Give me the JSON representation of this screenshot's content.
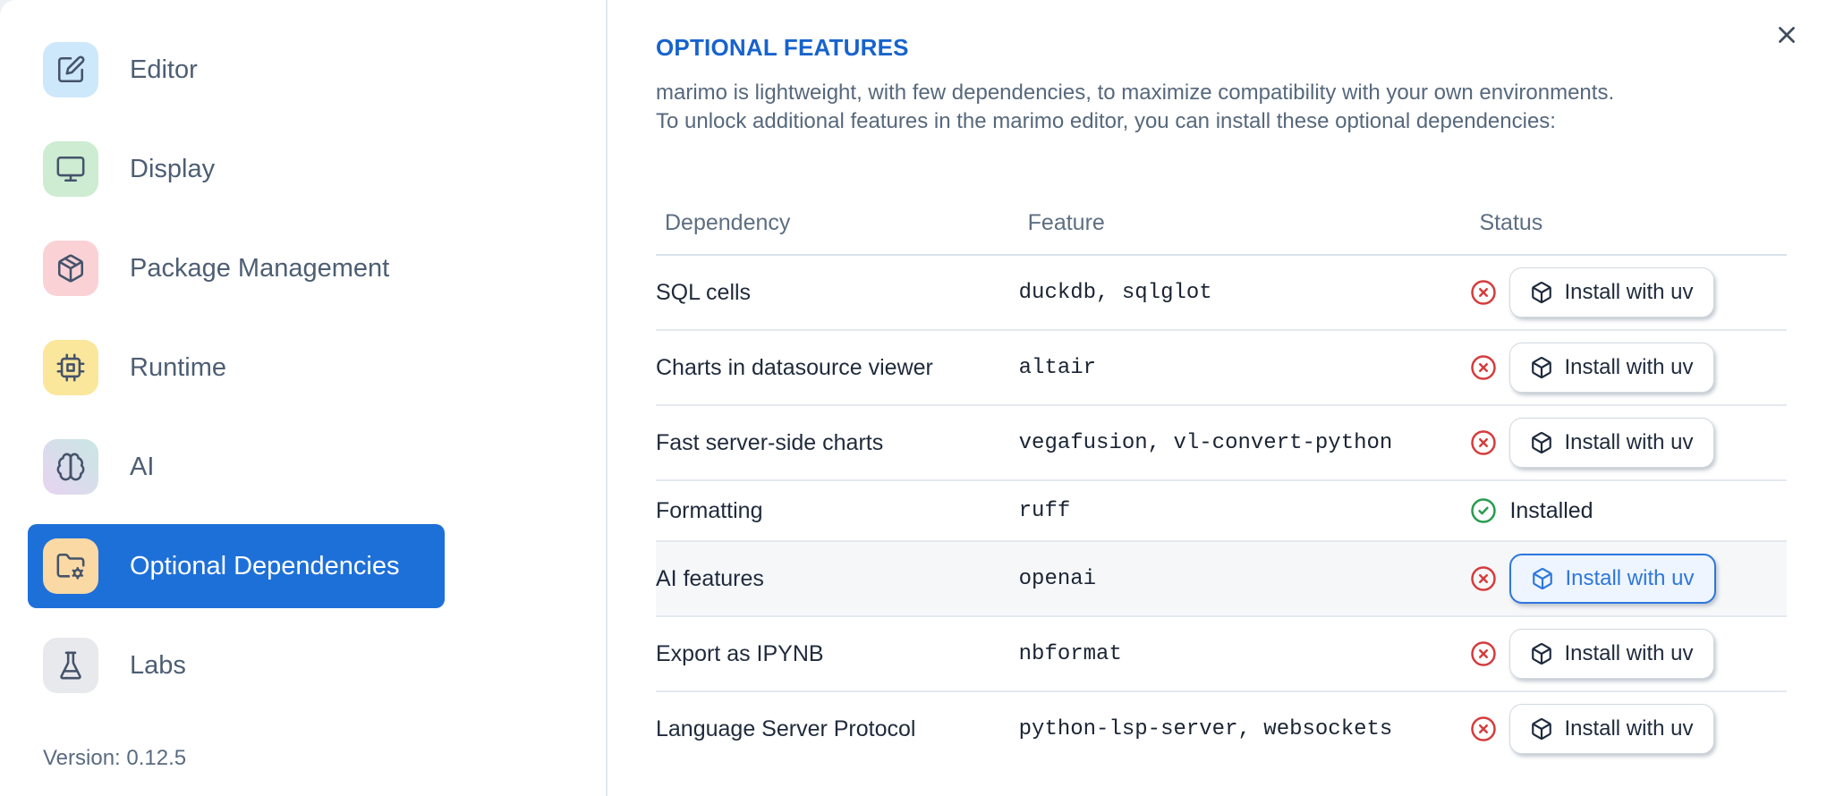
{
  "sidebar": {
    "items": [
      {
        "label": "Editor",
        "icon": "square-pen-icon",
        "icon_bg": "#cde8fb",
        "selected": false
      },
      {
        "label": "Display",
        "icon": "monitor-icon",
        "icon_bg": "#cdecd2",
        "selected": false
      },
      {
        "label": "Package Management",
        "icon": "package-icon",
        "icon_bg": "#fad2d6",
        "selected": false
      },
      {
        "label": "Runtime",
        "icon": "cpu-icon",
        "icon_bg": "#fae79c",
        "selected": false
      },
      {
        "label": "AI",
        "icon": "brain-icon",
        "icon_bg": "linear-gradient(to top right, #e7d3f1, #c9e7e4)",
        "selected": false
      },
      {
        "label": "Optional Dependencies",
        "icon": "folder-cog-icon",
        "icon_bg": "#fbd9a4",
        "selected": true
      },
      {
        "label": "Labs",
        "icon": "flask-icon",
        "icon_bg": "#e8e9ec",
        "selected": false
      }
    ],
    "version": "Version: 0.12.5"
  },
  "main": {
    "title": "OPTIONAL FEATURES",
    "description_line1": "marimo is lightweight, with few dependencies, to maximize compatibility with your own environments.",
    "description_line2": "To unlock additional features in the marimo editor, you can install these optional dependencies:",
    "table": {
      "headers": [
        "Dependency",
        "Feature",
        "Status"
      ],
      "install_button_label": "Install with uv",
      "installed_label": "Installed",
      "rows": [
        {
          "dependency": "SQL cells",
          "feature": "duckdb, sqlglot",
          "installed": false,
          "highlighted": false
        },
        {
          "dependency": "Charts in datasource viewer",
          "feature": "altair",
          "installed": false,
          "highlighted": false
        },
        {
          "dependency": "Fast server-side charts",
          "feature": "vegafusion, vl-convert-python",
          "installed": false,
          "highlighted": false
        },
        {
          "dependency": "Formatting",
          "feature": "ruff",
          "installed": true,
          "highlighted": false
        },
        {
          "dependency": "AI features",
          "feature": "openai",
          "installed": false,
          "highlighted": true
        },
        {
          "dependency": "Export as IPYNB",
          "feature": "nbformat",
          "installed": false,
          "highlighted": false
        },
        {
          "dependency": "Language Server Protocol",
          "feature": "python-lsp-server, websockets",
          "installed": false,
          "highlighted": false
        }
      ]
    }
  },
  "colors": {
    "accent_blue": "#2d77dd",
    "title_blue": "#1763cd",
    "selected_nav_bg": "#1e70d9",
    "status_red": "#d63c3c",
    "status_green": "#279c4e",
    "row_highlight_bg": "#f6f7f9"
  }
}
